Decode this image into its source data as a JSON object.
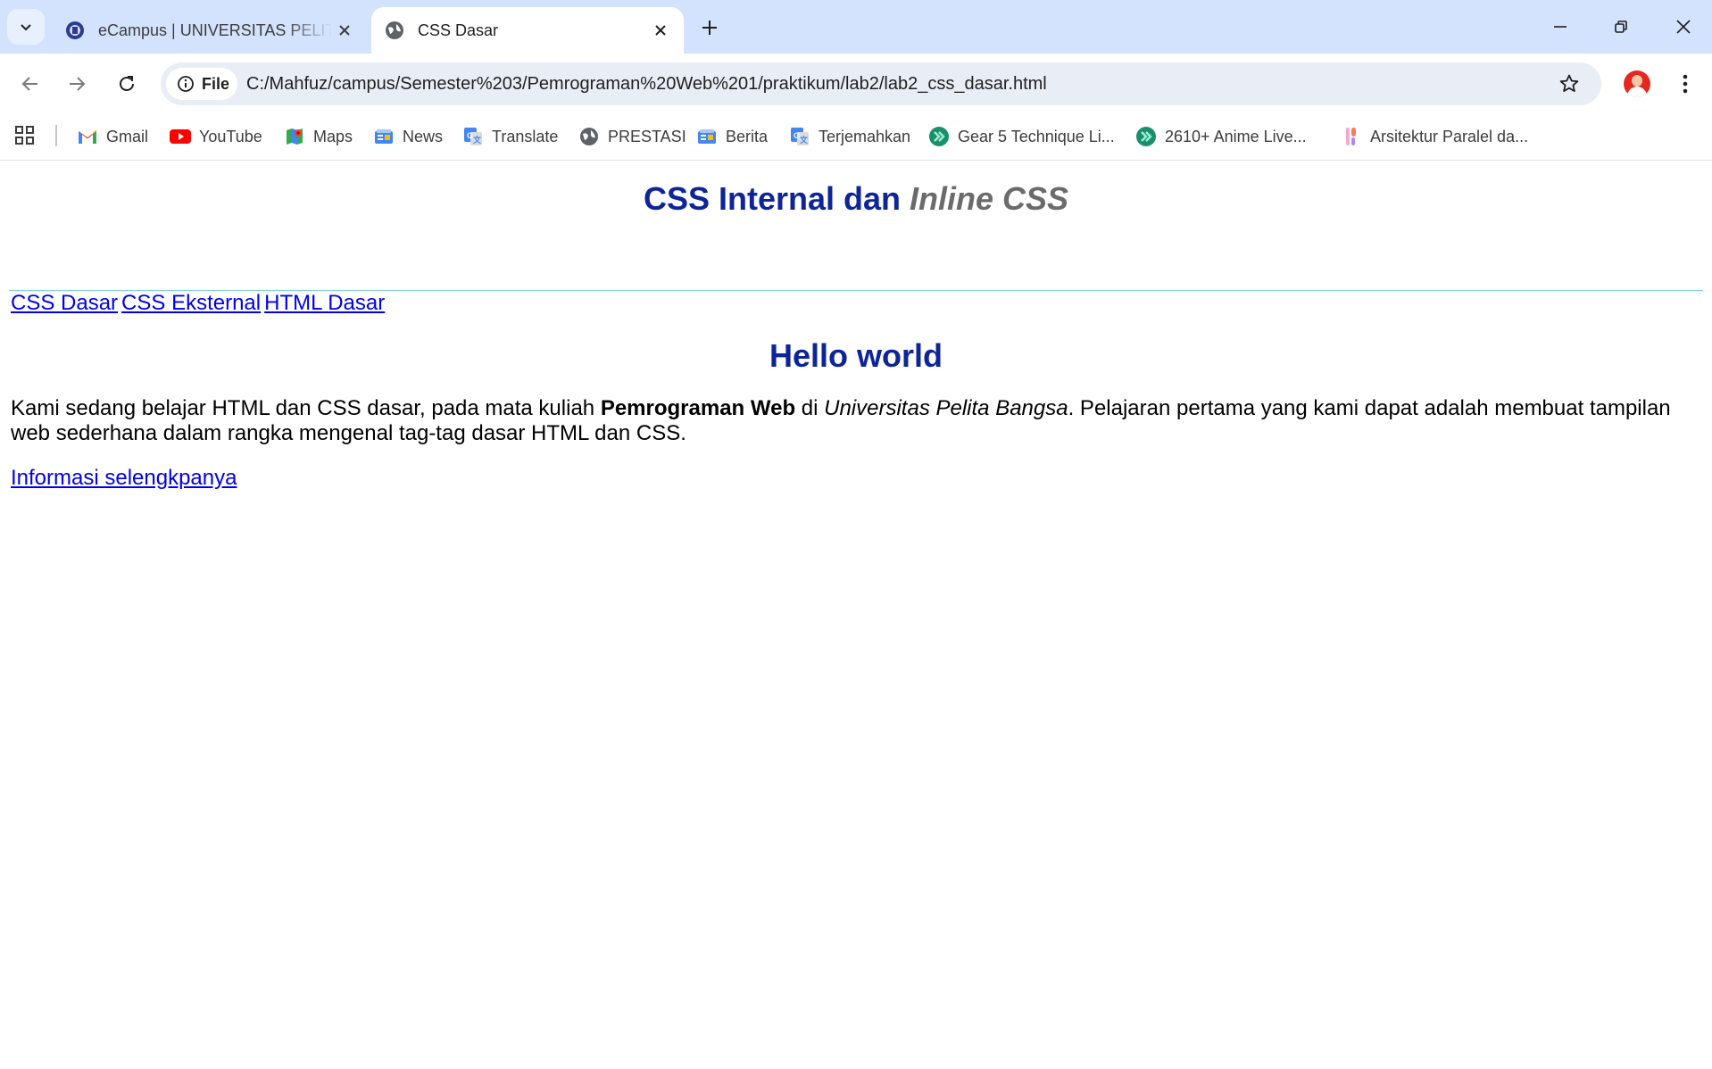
{
  "browser": {
    "tabs": [
      {
        "title": "eCampus | UNIVERSITAS PELITA BANGSA",
        "active": false,
        "favicon": "university-crest-icon"
      },
      {
        "title": "CSS Dasar",
        "active": true,
        "favicon": "globe-icon"
      }
    ],
    "address_bar": {
      "chip_label": "File",
      "url": "C:/Mahfuz/campus/Semester%203/Pemrograman%20Web%201/praktikum/lab2/lab2_css_dasar.html"
    },
    "bookmarks": [
      {
        "label": "Gmail",
        "icon": "gmail-icon"
      },
      {
        "label": "YouTube",
        "icon": "youtube-icon"
      },
      {
        "label": "Maps",
        "icon": "maps-icon"
      },
      {
        "label": "News",
        "icon": "news-icon"
      },
      {
        "label": "Translate",
        "icon": "translate-icon"
      },
      {
        "label": "PRESTASI",
        "icon": "globe-icon"
      },
      {
        "label": "Berita",
        "icon": "news-icon"
      },
      {
        "label": "Terjemahkan",
        "icon": "translate-icon"
      },
      {
        "label": "Gear 5 Technique Li...",
        "icon": "double-chevron-icon"
      },
      {
        "label": "2610+ Anime Live...",
        "icon": "double-chevron-icon"
      },
      {
        "label": "Arsitektur Paralel da...",
        "icon": "app-icon"
      }
    ],
    "colors": {
      "tab_strip": "#d3e3fd",
      "omnibox": "#e9eef6",
      "heading": "#0d2599",
      "link": "#0000ee"
    }
  },
  "page": {
    "title_main": "CSS Internal dan ",
    "title_italic": "Inline CSS",
    "nav_links": [
      "CSS Dasar",
      "CSS Eksternal",
      "HTML Dasar"
    ],
    "heading": "Hello world",
    "paragraph": {
      "part1": "Kami sedang belajar HTML dan CSS dasar, pada mata kuliah ",
      "bold": "Pemrograman Web",
      "part2": " di ",
      "italic": "Universitas Pelita Bangsa",
      "part3": ". Pelajaran pertama yang kami dapat adalah membuat tampilan web sederhana dalam rangka mengenal tag-tag dasar HTML dan CSS."
    },
    "more_link": "Informasi selengkpanya"
  }
}
